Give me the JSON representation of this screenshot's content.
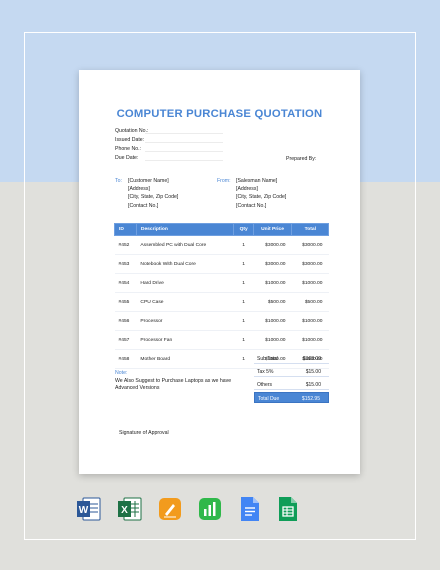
{
  "document": {
    "title": "COMPUTER PURCHASE QUOTATION",
    "meta_labels": [
      "Quotation No.:",
      "Issued Date:",
      "Phone No.:",
      "Due Date:"
    ],
    "prepared_by_label": "Prepared By:",
    "to": {
      "label": "To:",
      "lines": [
        "[Customer Name]",
        "[Address]",
        "[City, State, Zip Code]",
        "[Contact No.]"
      ]
    },
    "from": {
      "label": "From:",
      "lines": [
        "[Salesman Name]",
        "[Address]",
        "[City, State, Zip Code]",
        "[Contact No.]"
      ]
    },
    "table": {
      "headers": [
        "ID",
        "Description",
        "Qty",
        "Unit Price",
        "Total"
      ],
      "rows": [
        [
          "#452",
          "Assembled PC with Dual Core",
          "1",
          "$3000.00",
          "$3000.00"
        ],
        [
          "#453",
          "Notebook With Dual Core",
          "1",
          "$3000.00",
          "$3000.00"
        ],
        [
          "#454",
          "Hard Drive",
          "1",
          "$1000.00",
          "$1000.00"
        ],
        [
          "#455",
          "CPU Case",
          "1",
          "$500.00",
          "$500.00"
        ],
        [
          "#456",
          "Processor",
          "1",
          "$1000.00",
          "$1000.00"
        ],
        [
          "#457",
          "Processor Fan",
          "1",
          "$1000.00",
          "$1000.00"
        ],
        [
          "#458",
          "Mother Board",
          "1",
          "$1500.00",
          "$1500.00"
        ]
      ]
    },
    "summary": [
      {
        "label": "Sub Total",
        "value": "$168.00"
      },
      {
        "label": "Tax 5%",
        "value": "$15.00"
      },
      {
        "label": "Others",
        "value": "$15.00"
      },
      {
        "label": "Total Due",
        "value": "$152.95"
      }
    ],
    "note_label": "Note:",
    "note_text": "We Also Suggest to Purchase Laptops as we have Advanced Versions",
    "signature_label": "Signature of Approval"
  },
  "apps": {
    "word_letter": "W",
    "excel_letter": "X",
    "icon_names": [
      "word-icon",
      "excel-icon",
      "pages-icon",
      "numbers-icon",
      "google-docs-icon",
      "google-sheets-icon"
    ]
  },
  "colors": {
    "accent": "#4a86d4",
    "top_background": "#c5d9f1",
    "bottom_background": "#e0e0dc"
  }
}
